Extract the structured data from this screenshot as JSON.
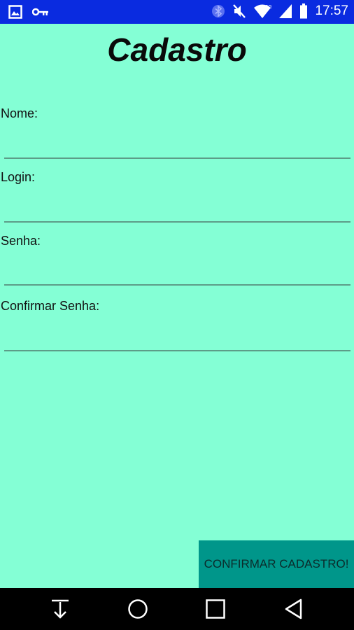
{
  "status_bar": {
    "time": "17:57",
    "icons": [
      "image-icon",
      "key-icon",
      "bluetooth-icon",
      "mute-icon",
      "wifi-icon",
      "signal-icon",
      "battery-icon"
    ]
  },
  "app": {
    "title": "Cadastro",
    "fields": [
      {
        "label": "Nome:",
        "value": "",
        "placeholder": ""
      },
      {
        "label": "Login:",
        "value": "",
        "placeholder": ""
      },
      {
        "label": "Senha:",
        "value": "",
        "placeholder": ""
      },
      {
        "label": "Confirmar Senha:",
        "value": "",
        "placeholder": ""
      }
    ],
    "confirm_label": "CONFIRMAR CADASTRO!"
  },
  "nav_bar": {
    "buttons": [
      "download-icon",
      "home-icon",
      "recents-icon",
      "back-icon"
    ]
  },
  "colors": {
    "status_bar": "#0A2BE0",
    "background": "#84FFD5",
    "button": "#00968A",
    "nav_bar": "#000000"
  }
}
